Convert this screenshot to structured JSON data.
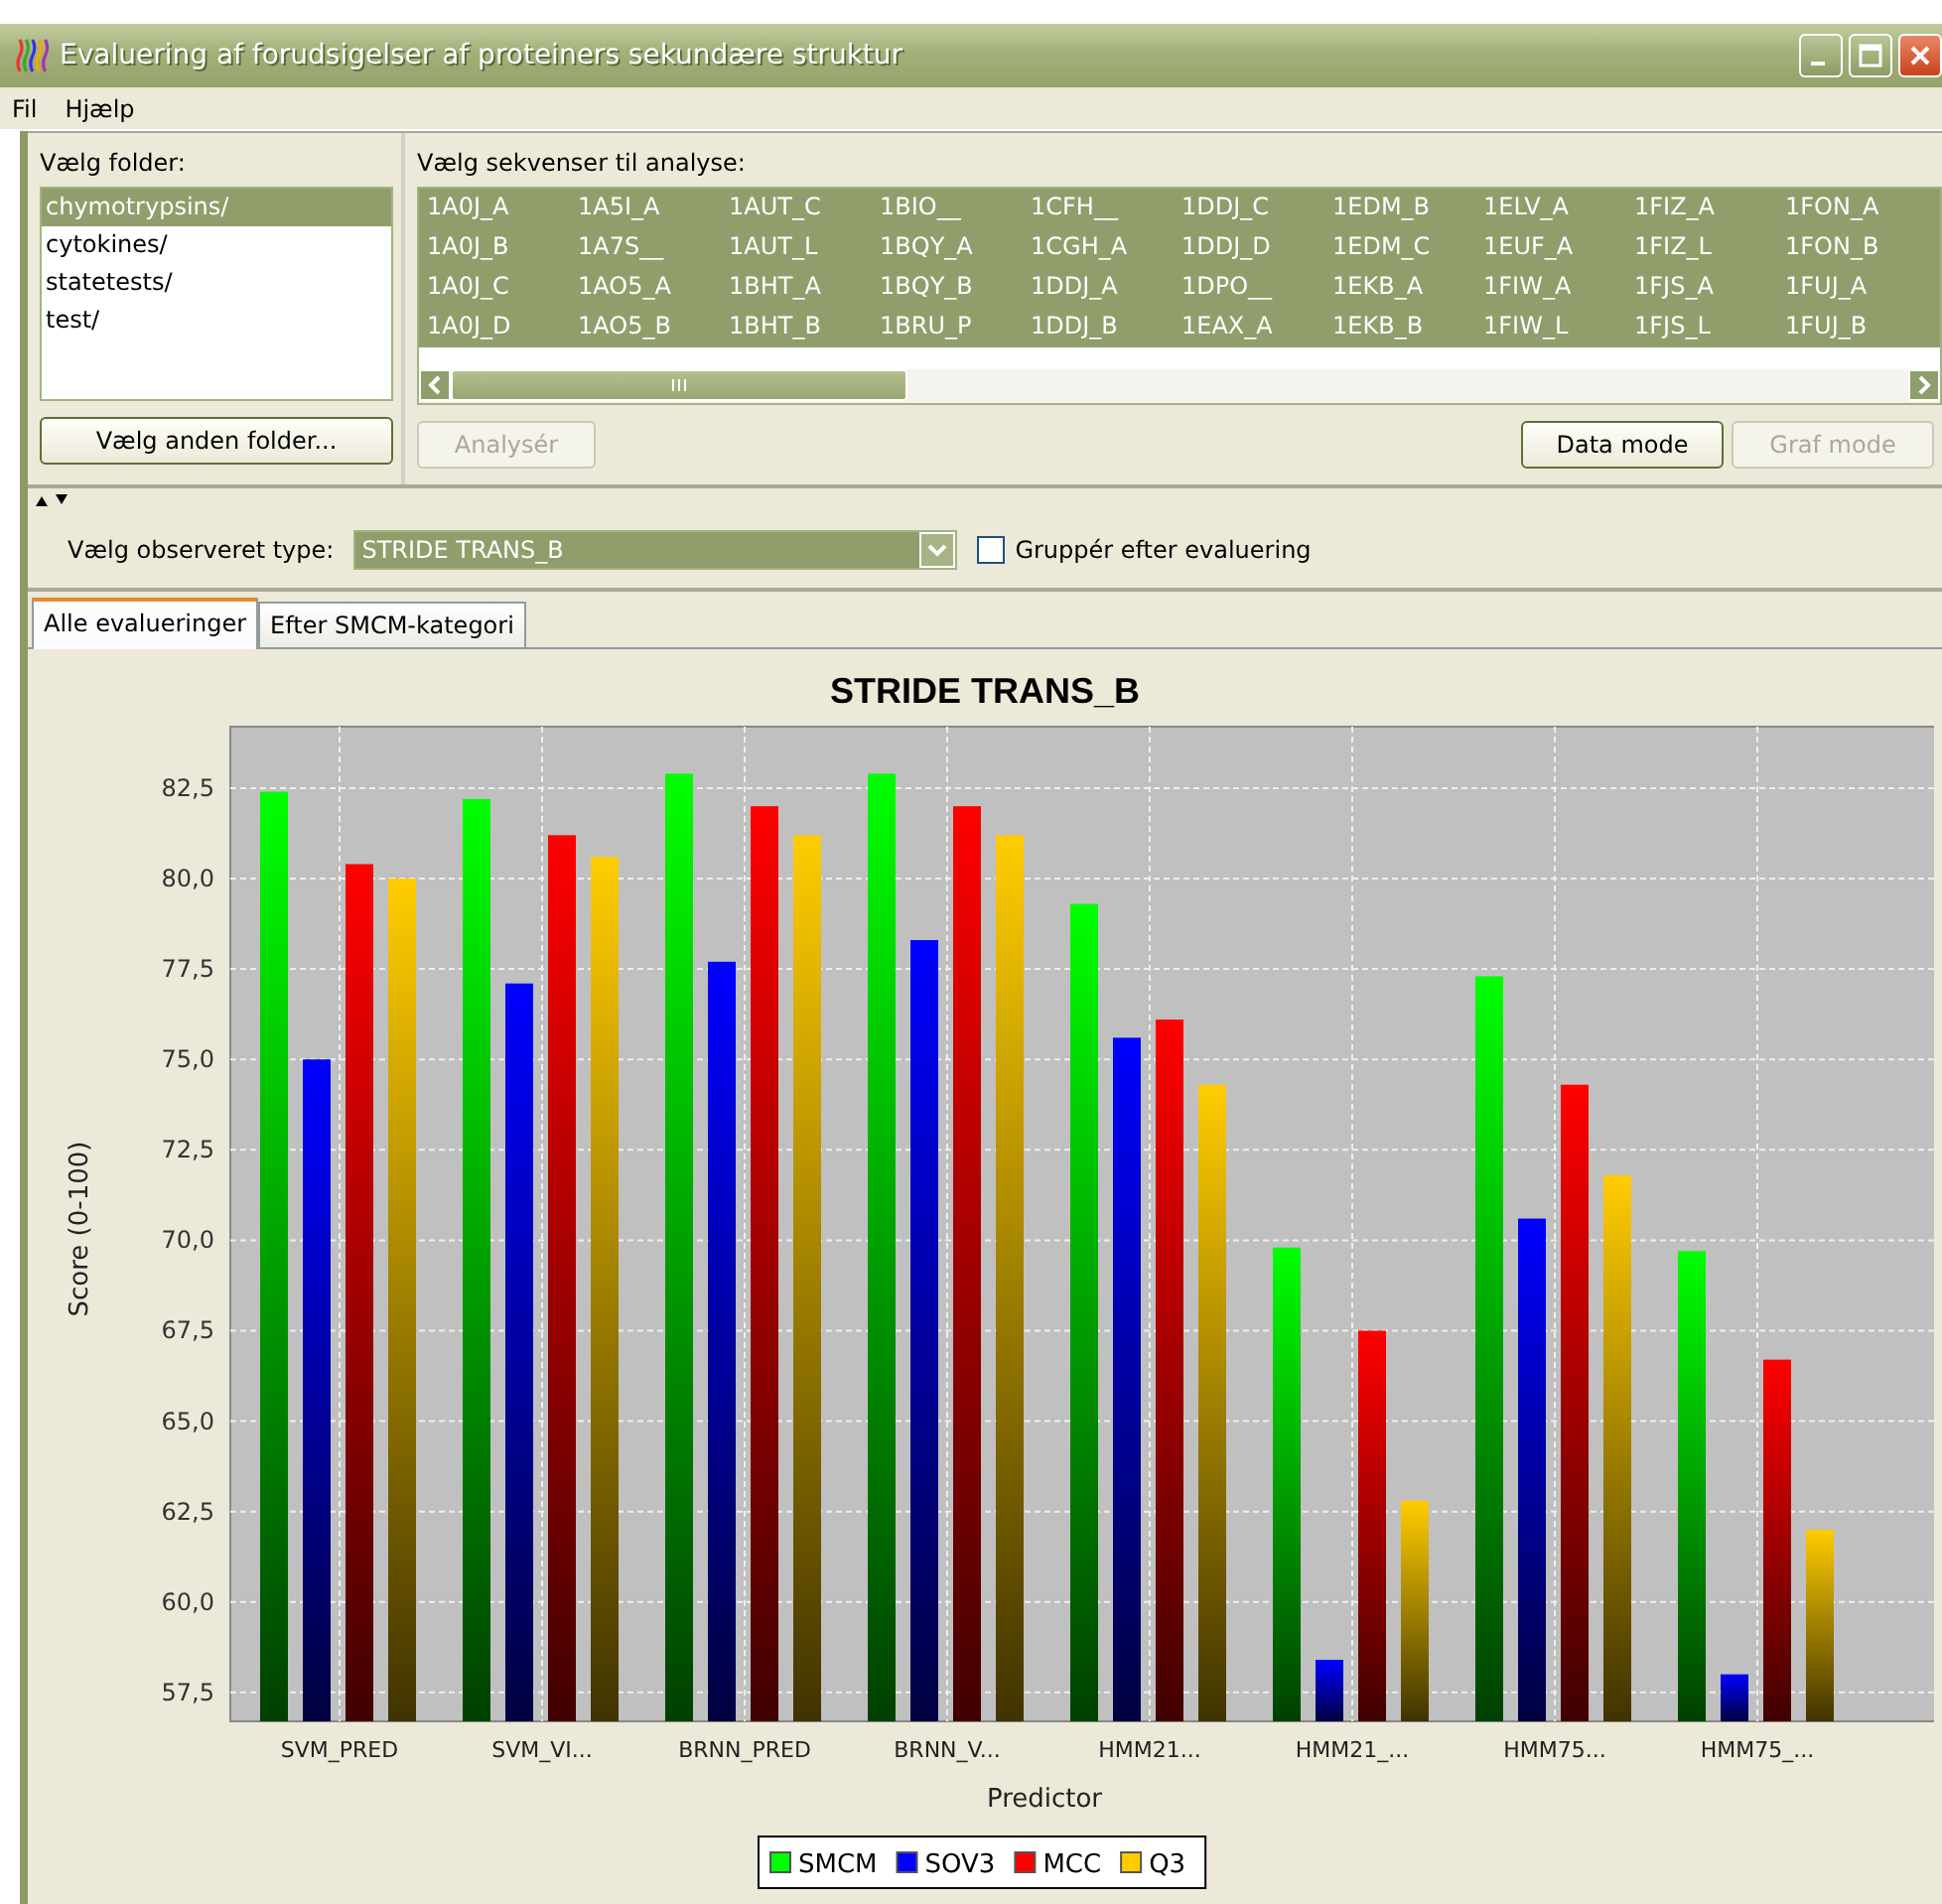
{
  "window": {
    "title": "Evaluering af forudsigelser af proteiners sekundære struktur"
  },
  "menu": [
    {
      "label": "Fil"
    },
    {
      "label": "Hjælp"
    }
  ],
  "folders": {
    "label": "Vælg folder:",
    "items": [
      {
        "label": "chymotrypsins/",
        "selected": true
      },
      {
        "label": "cytokines/",
        "selected": false
      },
      {
        "label": "statetests/",
        "selected": false
      },
      {
        "label": "test/",
        "selected": false
      }
    ],
    "button": {
      "label": "Vælg anden folder...",
      "disabled": false
    }
  },
  "sequences": {
    "label": "Vælg sekvenser til analyse:",
    "rows": [
      [
        {
          "label": "1A0J_A",
          "selected": true
        },
        {
          "label": "1A5I_A",
          "selected": true
        },
        {
          "label": "1AUT_C",
          "selected": true
        },
        {
          "label": "1BIO__",
          "selected": true
        },
        {
          "label": "1CFH__",
          "selected": true
        },
        {
          "label": "1DDJ_C",
          "selected": true
        },
        {
          "label": "1EDM_B",
          "selected": true
        },
        {
          "label": "1ELV_A",
          "selected": true
        },
        {
          "label": "1FIZ_A",
          "selected": true
        },
        {
          "label": "1FON_A",
          "selected": true
        }
      ],
      [
        {
          "label": "1A0J_B",
          "selected": true
        },
        {
          "label": "1A7S__",
          "selected": true
        },
        {
          "label": "1AUT_L",
          "selected": true
        },
        {
          "label": "1BQY_A",
          "selected": true
        },
        {
          "label": "1CGH_A",
          "selected": true
        },
        {
          "label": "1DDJ_D",
          "selected": true
        },
        {
          "label": "1EDM_C",
          "selected": true
        },
        {
          "label": "1EUF_A",
          "selected": true
        },
        {
          "label": "1FIZ_L",
          "selected": true
        },
        {
          "label": "1FON_B",
          "selected": true
        }
      ],
      [
        {
          "label": "1A0J_C",
          "selected": true
        },
        {
          "label": "1AO5_A",
          "selected": true
        },
        {
          "label": "1BHT_A",
          "selected": true
        },
        {
          "label": "1BQY_B",
          "selected": true
        },
        {
          "label": "1DDJ_A",
          "selected": true
        },
        {
          "label": "1DPO__",
          "selected": true
        },
        {
          "label": "1EKB_A",
          "selected": true
        },
        {
          "label": "1FIW_A",
          "selected": true
        },
        {
          "label": "1FJS_A",
          "selected": true
        },
        {
          "label": "1FUJ_A",
          "selected": true
        }
      ],
      [
        {
          "label": "1A0J_D",
          "selected": true
        },
        {
          "label": "1AO5_B",
          "selected": true
        },
        {
          "label": "1BHT_B",
          "selected": true
        },
        {
          "label": "1BRU_P",
          "selected": true
        },
        {
          "label": "1DDJ_B",
          "selected": true
        },
        {
          "label": "1EAX_A",
          "selected": true
        },
        {
          "label": "1EKB_B",
          "selected": true
        },
        {
          "label": "1FIW_L",
          "selected": true
        },
        {
          "label": "1FJS_L",
          "selected": true
        },
        {
          "label": "1FUJ_B",
          "selected": true
        }
      ]
    ],
    "buttons": [
      {
        "label": "Analysér",
        "disabled": true
      },
      {
        "label": "Data mode",
        "disabled": false
      },
      {
        "label": "Graf mode",
        "disabled": true
      }
    ]
  },
  "observed": {
    "label": "Vælg observeret type:",
    "value": "STRIDE TRANS_B"
  },
  "group_checkbox": {
    "label": "Gruppér efter evaluering",
    "checked": false
  },
  "results": {
    "tabs": [
      {
        "label": "Alle evalueringer",
        "selected": true
      },
      {
        "label": "Efter SMCM-kategori",
        "selected": false
      }
    ],
    "chart_data": {
      "type": "bar",
      "title": "STRIDE TRANS_B",
      "xlabel": "Predictor",
      "ylabel": "Score (0-100)",
      "categories": [
        "SVM_PRED",
        "SVM_VI...",
        "BRNN_PRED",
        "BRNN_V...",
        "HMM21...",
        "HMM21_...",
        "HMM75...",
        "HMM75_..."
      ],
      "series": [
        {
          "name": "SMCM",
          "color": "#00ff00",
          "values": [
            82.4,
            82.2,
            82.9,
            82.9,
            79.3,
            69.8,
            77.3,
            69.7
          ]
        },
        {
          "name": "SOV3",
          "color": "#0000ff",
          "values": [
            75.0,
            77.1,
            77.7,
            78.3,
            75.6,
            58.4,
            70.6,
            58.0
          ]
        },
        {
          "name": "MCC",
          "color": "#ff0000",
          "values": [
            80.4,
            81.2,
            82.0,
            82.0,
            76.1,
            67.5,
            74.3,
            66.7
          ]
        },
        {
          "name": "Q3",
          "color": "#ffcc00",
          "values": [
            80.0,
            80.6,
            81.2,
            81.2,
            74.3,
            62.8,
            71.8,
            62.0
          ]
        }
      ],
      "ylim": [
        56.7,
        84.2
      ],
      "grid": true,
      "legend": true,
      "yticks": [
        {
          "value": 57.5,
          "label": "57,5"
        },
        {
          "value": 60,
          "label": "60,0"
        },
        {
          "value": 62.5,
          "label": "62,5"
        },
        {
          "value": 65,
          "label": "65,0"
        },
        {
          "value": 67.5,
          "label": "67,5"
        },
        {
          "value": 70,
          "label": "70,0"
        },
        {
          "value": 72.5,
          "label": "72,5"
        },
        {
          "value": 75,
          "label": "75,0"
        },
        {
          "value": 77.5,
          "label": "77,5"
        },
        {
          "value": 80,
          "label": "80,0"
        },
        {
          "value": 82.5,
          "label": "82,5"
        }
      ]
    }
  }
}
